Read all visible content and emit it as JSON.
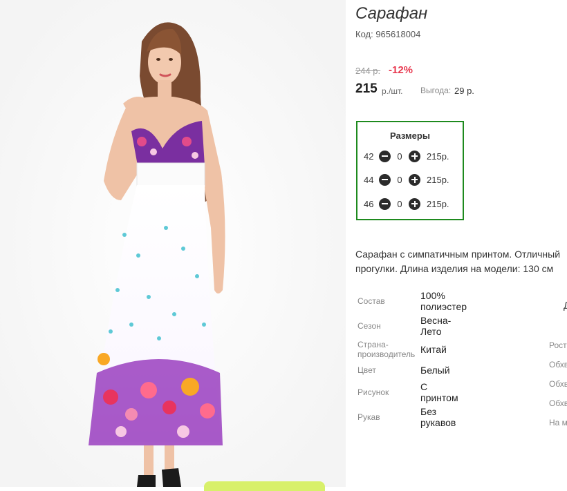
{
  "product": {
    "title": "Сарафан",
    "code": "Код: 965618004",
    "old_price": "244 р.",
    "discount": "-12%",
    "price": "215",
    "price_unit": "р./шт.",
    "benefit_label": "Выгода:",
    "benefit_value": "29 р."
  },
  "sizes": {
    "title": "Размеры",
    "rows": [
      {
        "size": "42",
        "qty": "0",
        "price": "215р."
      },
      {
        "size": "44",
        "qty": "0",
        "price": "215р."
      },
      {
        "size": "46",
        "qty": "0",
        "price": "215р."
      }
    ]
  },
  "description": {
    "line1": "Сарафан с симпатичным принтом. Отличный",
    "line2": "прогулки. Длина изделия на модели: 130 см"
  },
  "specs": [
    {
      "label": "Состав",
      "value1": "100%",
      "value2": "полиэстер"
    },
    {
      "label": "Сезон",
      "value1": "Весна-",
      "value2": "Лето"
    },
    {
      "label1": "Страна-",
      "label2": "производитель",
      "value": "Китай"
    },
    {
      "label": "Цвет",
      "value": "Белый"
    },
    {
      "label": "Рисунок",
      "value1": "С",
      "value2": "принтом"
    },
    {
      "label": "Рукав",
      "value1": "Без",
      "value2": "рукавов"
    }
  ],
  "specs_right": [
    "Рост",
    "Обхв",
    "Обхв",
    "Обхв",
    "На м"
  ],
  "cut_glyph": "Д",
  "colors": {
    "discount": "#e8384f",
    "sizes_border": "#1e8a1e",
    "buy_button": "#d8f06a"
  }
}
